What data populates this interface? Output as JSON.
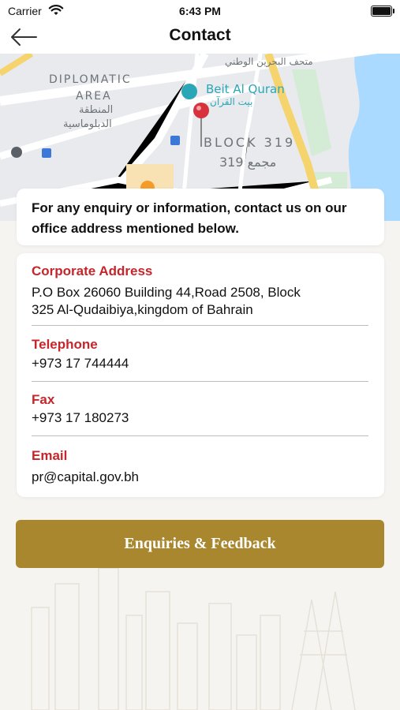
{
  "status_bar": {
    "carrier": "Carrier",
    "time": "6:43 PM"
  },
  "nav": {
    "title": "Contact"
  },
  "map": {
    "labels": {
      "diplomatic_1": "DIPLOMATIC",
      "diplomatic_2": "AREA",
      "diplomatic_ar_1": "المنطقة",
      "diplomatic_ar_2": "الدبلوماسية",
      "museum_ar": "متحف البحرين الوطني",
      "beit_al_quran": "Beit Al Quran",
      "beit_al_quran_ar": "بيت القرآن",
      "block": "BLOCK 319",
      "block_ar": "319 مجمع"
    }
  },
  "enquiry": {
    "text": "For any enquiry or information, contact us on our office address mentioned below."
  },
  "contact": {
    "address_label": "Corporate Address",
    "address_line1": "P.O Box 26060 Building 44,Road 2508, Block",
    "address_line2": "325 Al-Qudaibiya,kingdom of Bahrain",
    "telephone_label": "Telephone",
    "telephone": "+973 17 744444",
    "fax_label": "Fax",
    "fax": "+973 17 180273",
    "email_label": "Email",
    "email": "pr@capital.gov.bh"
  },
  "button": {
    "label": "Enquiries & Feedback"
  },
  "colors": {
    "accent_red": "#c5262b",
    "button_gold": "#a9872e",
    "background": "#f6f4f1",
    "map_pin": "#d8323c",
    "quran_icon": "#2aa7b7"
  }
}
